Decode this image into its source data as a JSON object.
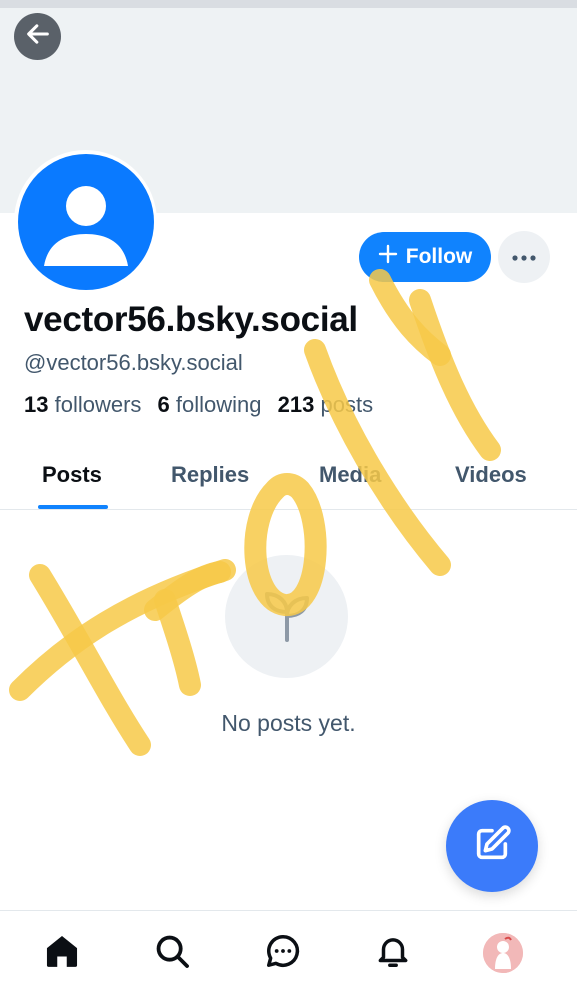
{
  "header": {
    "back_icon": "arrow-left-icon"
  },
  "profile": {
    "display_name": "vector56.bsky.social",
    "handle": "@vector56.bsky.social",
    "follow_label": "Follow",
    "more_icon": "ellipsis-icon",
    "stats": {
      "followers_count": "13",
      "followers_label": "followers",
      "following_count": "6",
      "following_label": "following",
      "posts_count": "213",
      "posts_label": "posts"
    }
  },
  "tabs": [
    {
      "label": "Posts",
      "active": true
    },
    {
      "label": "Replies",
      "active": false
    },
    {
      "label": "Media",
      "active": false
    },
    {
      "label": "Videos",
      "active": false
    }
  ],
  "empty_state": {
    "icon": "seedling-icon",
    "message": "No posts yet."
  },
  "fab": {
    "icon": "compose-icon"
  },
  "bottom_nav": [
    {
      "name": "home",
      "icon": "home-icon"
    },
    {
      "name": "search",
      "icon": "search-icon"
    },
    {
      "name": "chat",
      "icon": "chat-icon"
    },
    {
      "name": "notifications",
      "icon": "bell-icon"
    },
    {
      "name": "profile",
      "icon": "avatar"
    }
  ],
  "annotation": {
    "handwritten_text": "troll",
    "color": "#f7c948"
  },
  "colors": {
    "accent": "#1083fe",
    "avatar_bg": "#0a7aff",
    "fab_bg": "#3b7bfa",
    "muted_text": "#42576c"
  }
}
